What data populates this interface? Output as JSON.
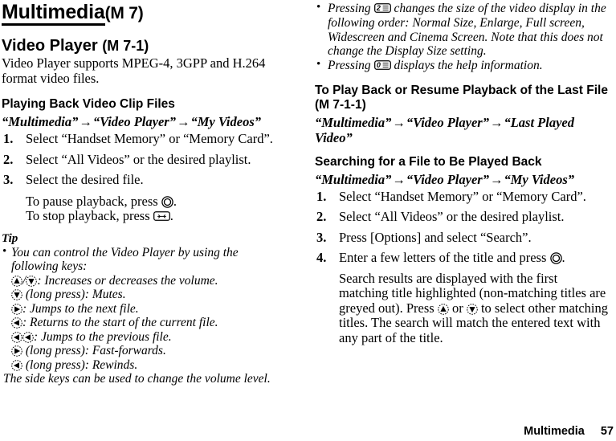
{
  "document": {
    "chapter_title": "Multimedia",
    "chapter_code": "(M 7)"
  },
  "left_column": {
    "section": {
      "title": "Video Player",
      "code": "(M 7-1)",
      "intro": "Video Player supports MPEG-4, 3GPP and H.264 format video files."
    },
    "playback": {
      "heading": "Playing Back Video Clip Files",
      "breadcrumb": {
        "part1": "“Multimedia”",
        "part2": "“Video Player”",
        "part3": "“My Videos”",
        "arrow": "→"
      },
      "steps": [
        {
          "num": "1.",
          "text": "Select “Handset Memory” or “Memory Card”."
        },
        {
          "num": "2.",
          "text": "Select “All Videos” or the desired playlist."
        },
        {
          "num": "3.",
          "text": "Select the desired file."
        }
      ],
      "pause_prefix": "To pause playback, press",
      "pause_suffix": ".",
      "stop_prefix": "To stop playback, press",
      "stop_suffix": "."
    },
    "tip": {
      "title": "Tip",
      "intro_line1": "You can control the Video Player by using the",
      "intro_line2": "following keys:",
      "keys": [
        {
          "icons": [
            "up",
            "down"
          ],
          "separator": "/",
          "text": ": Increases or decreases the volume."
        },
        {
          "icons": [
            "down"
          ],
          "separator": "",
          "text": "(long press): Mutes."
        },
        {
          "icons": [
            "right"
          ],
          "separator": "",
          "text": ": Jumps to the next file."
        },
        {
          "icons": [
            "left"
          ],
          "separator": "",
          "text": ": Returns to the start of the current file."
        },
        {
          "icons": [
            "left",
            "left"
          ],
          "separator": "",
          "text": ": Jumps to the previous file."
        },
        {
          "icons": [
            "right"
          ],
          "separator": "",
          "text": "(long press): Fast-forwards."
        },
        {
          "icons": [
            "left"
          ],
          "separator": "",
          "text": "(long press): Rewinds."
        }
      ],
      "closing": "The side keys can be used to change the volume level."
    }
  },
  "right_column": {
    "bullets": [
      {
        "prefix": "Pressing",
        "key_label": "2",
        "text": "changes the size of the video display in the following order: Normal Size, Enlarge, Full screen, Widescreen and Cinema Screen. Note that this does not change the Display Size setting."
      },
      {
        "prefix": "Pressing",
        "key_label": "0",
        "text": "displays the help information."
      }
    ],
    "last_file": {
      "heading": "To Play Back or Resume Playback of the Last File",
      "heading_code": "(M 7-1-1)",
      "breadcrumb": {
        "part1": "“Multimedia”",
        "part2": "“Video Player”",
        "part3": "“Last Played Video”",
        "arrow": "→"
      }
    },
    "search": {
      "heading": "Searching for a File to Be Played Back",
      "breadcrumb": {
        "part1": "“Multimedia”",
        "part2": "“Video Player”",
        "part3": "“My Videos”",
        "arrow": "→"
      },
      "steps": [
        {
          "num": "1.",
          "text": "Select “Handset Memory” or “Memory Card”."
        },
        {
          "num": "2.",
          "text": "Select “All Videos” or the desired playlist."
        },
        {
          "num": "3.",
          "text": "Press [Options] and select “Search”."
        }
      ],
      "step4": {
        "num": "4.",
        "prefix": "Enter a few letters of the title and press",
        "suffix": "."
      },
      "result_part1": "Search results are displayed with the first matching title highlighted (non-matching titles are greyed out). Press",
      "result_or": "or",
      "result_part2": "to select other matching titles. The search will match the entered text with any part of the title."
    }
  },
  "footer": {
    "chapter": "Multimedia",
    "page_number": "57"
  }
}
